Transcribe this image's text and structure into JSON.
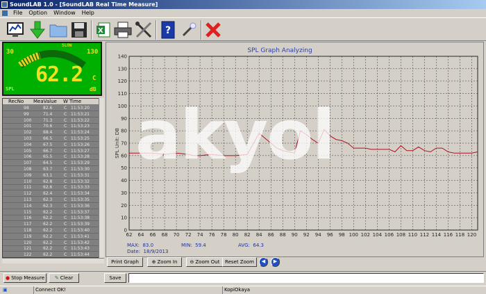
{
  "window": {
    "title": "SoundLAB 1.0 - [SoundLAB Real Time Measure]"
  },
  "menu": [
    "File",
    "Option",
    "Window",
    "Help"
  ],
  "toolbar": {
    "icons": [
      "monitor-graph-icon",
      "green-arrow-down-icon",
      "open-folder-icon",
      "save-disk-icon",
      "excel-export-icon",
      "printer-icon",
      "tools-icon",
      "help-book-icon",
      "magic-wand-icon",
      "close-x-icon"
    ]
  },
  "meter": {
    "min": "30",
    "max": "130",
    "mode": "SLOW",
    "value": "62.2",
    "weighting": "C",
    "unit": "dB",
    "label": "SPL",
    "level_fraction": 0.32
  },
  "table": {
    "columns": [
      "RecNo",
      "MeaValue",
      "W",
      "Time"
    ],
    "rows": [
      [
        "98",
        "82.6",
        "C",
        "11:53:20"
      ],
      [
        "99",
        "71.4",
        "C",
        "11:53:21"
      ],
      [
        "100",
        "71.3",
        "C",
        "11:53:22"
      ],
      [
        "101",
        "70.6",
        "C",
        "11:53:23"
      ],
      [
        "102",
        "68.4",
        "C",
        "11:53:24"
      ],
      [
        "103",
        "66.5",
        "C",
        "11:53:25"
      ],
      [
        "104",
        "67.5",
        "C",
        "11:53:26"
      ],
      [
        "105",
        "66.7",
        "C",
        "11:53:27"
      ],
      [
        "106",
        "65.5",
        "C",
        "11:53:28"
      ],
      [
        "107",
        "64.5",
        "C",
        "11:53:29"
      ],
      [
        "108",
        "63.7",
        "C",
        "11:53:30"
      ],
      [
        "109",
        "63.1",
        "C",
        "11:53:31"
      ],
      [
        "110",
        "62.8",
        "C",
        "11:53:32"
      ],
      [
        "111",
        "62.6",
        "C",
        "11:53:33"
      ],
      [
        "112",
        "62.4",
        "C",
        "11:53:34"
      ],
      [
        "113",
        "62.3",
        "C",
        "11:53:35"
      ],
      [
        "114",
        "62.3",
        "C",
        "11:53:36"
      ],
      [
        "115",
        "62.2",
        "C",
        "11:53:37"
      ],
      [
        "116",
        "62.2",
        "C",
        "11:53:38"
      ],
      [
        "117",
        "62.2",
        "C",
        "11:53:39"
      ],
      [
        "118",
        "62.2",
        "C",
        "11:53:40"
      ],
      [
        "119",
        "62.2",
        "C",
        "11:53:41"
      ],
      [
        "120",
        "62.2",
        "C",
        "11:53:42"
      ],
      [
        "121",
        "62.2",
        "C",
        "11:53:43"
      ],
      [
        "122",
        "62.2",
        "C",
        "11:53:44"
      ]
    ]
  },
  "chart_data": {
    "type": "line",
    "title": "SPL Graph Analyzing",
    "ylabel": "SPL Unit: DB",
    "xlabel": "",
    "xlim": [
      62,
      121
    ],
    "ylim": [
      0,
      140
    ],
    "xticks": [
      62,
      64,
      66,
      68,
      70,
      72,
      74,
      76,
      78,
      80,
      82,
      84,
      86,
      88,
      90,
      92,
      94,
      96,
      98,
      100,
      102,
      104,
      106,
      108,
      110,
      112,
      114,
      116,
      118,
      120
    ],
    "yticks": [
      0,
      10,
      20,
      30,
      40,
      50,
      60,
      70,
      80,
      90,
      100,
      110,
      120,
      130,
      140
    ],
    "grid": true,
    "line_color": "#b01020",
    "series": [
      {
        "x": [
          62,
          64,
          66,
          68,
          70,
          72,
          73,
          74,
          76,
          78,
          80,
          82,
          84,
          85,
          86,
          87,
          88,
          89,
          90,
          91,
          92,
          93,
          94,
          95,
          96,
          97,
          98,
          99,
          100,
          101,
          102,
          103,
          104,
          105,
          106,
          107,
          108,
          109,
          110,
          111,
          112,
          113,
          114,
          115,
          116,
          117,
          118,
          119,
          120,
          121
        ],
        "y": [
          62,
          62,
          62,
          61,
          62,
          61,
          60,
          60,
          61,
          60,
          60,
          61,
          78,
          74,
          70,
          66,
          64,
          63,
          62,
          80,
          77,
          73,
          70,
          81,
          76,
          73,
          72,
          70,
          66,
          66,
          66,
          65,
          65,
          65,
          65,
          63,
          68,
          64,
          64,
          67,
          64,
          63,
          66,
          66,
          63,
          62,
          62,
          62,
          62,
          63
        ]
      }
    ],
    "stats": {
      "max_label": "MAX:",
      "max": "83.0",
      "min_label": "MIN:",
      "min": "59.4",
      "avg_label": "AVG:",
      "avg": "64.3",
      "date_label": "Date:",
      "date": "18/9/2013"
    }
  },
  "chart_buttons": {
    "print": "Print Graph",
    "zoom_in": "Zoom In",
    "zoom_out": "Zoom Out",
    "reset": "Reset Zoom"
  },
  "bottom": {
    "stop": "Stop Measure",
    "clear": "Clear",
    "save": "Save",
    "save_input": ""
  },
  "status": {
    "connection": "Connect OK!",
    "user": "KopiOkaya"
  },
  "watermark": "akyol"
}
